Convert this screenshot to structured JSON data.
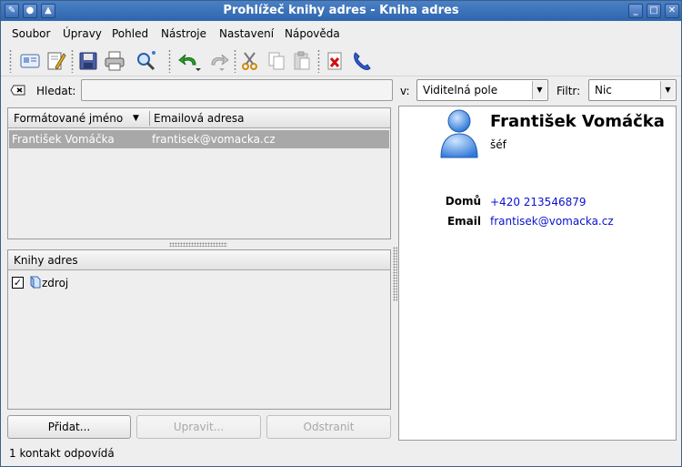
{
  "window": {
    "title": "Prohlížeč knihy adres - Kniha adres"
  },
  "menu": [
    {
      "label": "Soubor"
    },
    {
      "label": "Úpravy"
    },
    {
      "label": "Pohled"
    },
    {
      "label": "Nástroje"
    },
    {
      "label": "Nastavení"
    },
    {
      "label": "Nápověda"
    }
  ],
  "search": {
    "label": "Hledat:",
    "value": "",
    "view_label": "v:",
    "view_value": "Viditelná pole",
    "filter_label": "Filtr:",
    "filter_value": "Nic"
  },
  "contacts": {
    "columns": [
      "Formátované jméno",
      "Emailová adresa"
    ],
    "rows": [
      {
        "name": "František Vomáčka",
        "email": "frantisek@vomacka.cz"
      }
    ]
  },
  "addressbooks": {
    "header": "Knihy adres",
    "items": [
      {
        "label": "zdroj",
        "checked": true
      }
    ]
  },
  "buttons": {
    "add": "Přidat...",
    "edit": "Upravit...",
    "remove": "Odstranit"
  },
  "detail": {
    "name": "František Vomáčka",
    "role": "šéf",
    "home_label": "Domů",
    "home_value": "+420 213546879",
    "email_label": "Email",
    "email_value": "frantisek@vomacka.cz"
  },
  "status": {
    "text": "1 kontakt odpovídá"
  },
  "colors": {
    "titlebar": "#2f65ad",
    "link": "#0a12cc",
    "selection": "#a8a8a8"
  }
}
